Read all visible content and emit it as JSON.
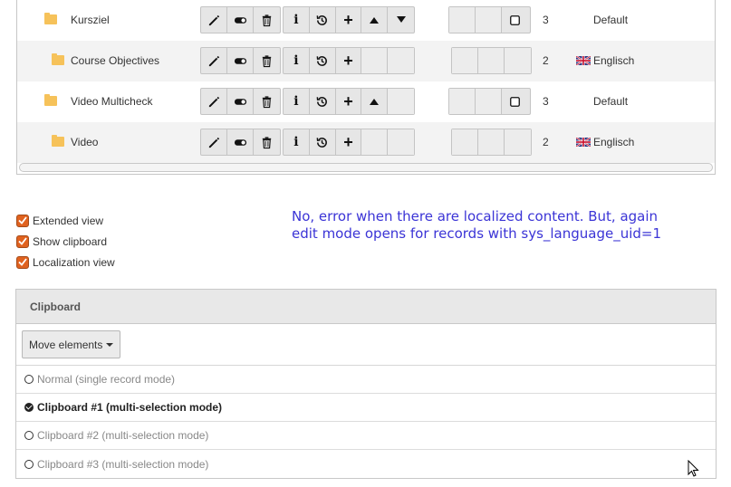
{
  "records": [
    {
      "title": "Kursziel",
      "level": "3",
      "language": "Default",
      "flag": false,
      "indent": 0
    },
    {
      "title": "Course Objectives",
      "level": "2",
      "language": "Englisch",
      "flag": true,
      "indent": 1
    },
    {
      "title": "Video Multicheck",
      "level": "3",
      "language": "Default",
      "flag": false,
      "indent": 0
    },
    {
      "title": "Video",
      "level": "2",
      "language": "Englisch",
      "flag": true,
      "indent": 1
    }
  ],
  "options": {
    "extended_view": "Extended view",
    "show_clipboard": "Show clipboard",
    "localization_view": "Localization view"
  },
  "note": "No, error when there are localized content. But, again edit mode opens for records with sys_language_uid=1",
  "clipboard": {
    "title": "Clipboard",
    "move_label": "Move elements",
    "modes": [
      {
        "label": "Normal (single record mode)",
        "selected": false
      },
      {
        "label": "Clipboard #1 (multi-selection mode)",
        "selected": true
      },
      {
        "label": "Clipboard #2 (multi-selection mode)",
        "selected": false
      },
      {
        "label": "Clipboard #3 (multi-selection mode)",
        "selected": false
      }
    ]
  },
  "colors": {
    "folder": "#f6c25a",
    "checkbox": "#e0621f",
    "note_text": "#3b34d6"
  }
}
